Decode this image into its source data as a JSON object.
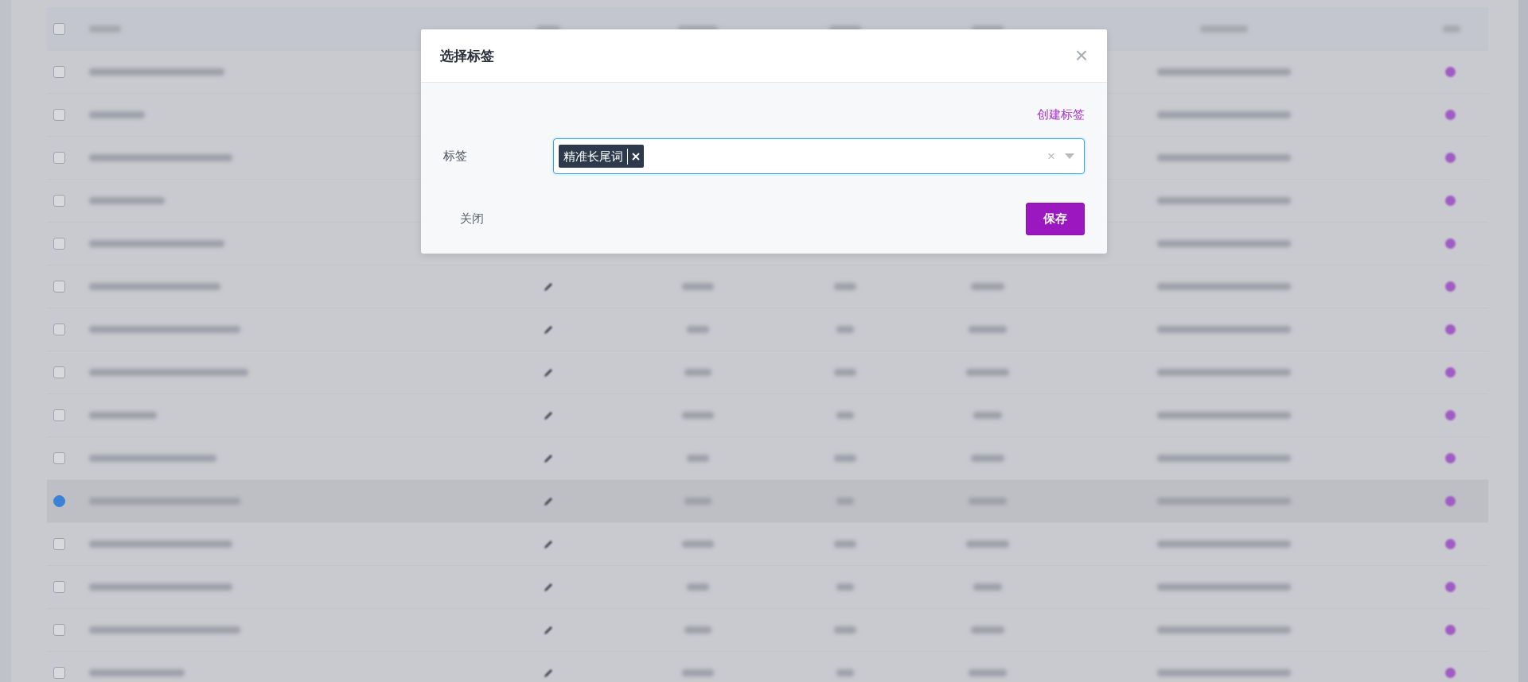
{
  "background_table": {
    "header_checkbox": {
      "checked": false
    },
    "rows": [
      {
        "selected": false
      },
      {
        "selected": false
      },
      {
        "selected": false
      },
      {
        "selected": false
      },
      {
        "selected": false
      },
      {
        "selected": false
      },
      {
        "selected": false
      },
      {
        "selected": false
      },
      {
        "selected": false
      },
      {
        "selected": false
      },
      {
        "selected": true
      },
      {
        "selected": false
      },
      {
        "selected": false
      },
      {
        "selected": false
      },
      {
        "selected": false
      }
    ]
  },
  "dialog": {
    "title": "选择标签",
    "close_icon": "×",
    "create_link": "创建标签",
    "field_label": "标签",
    "tags": [
      {
        "label": "精准长尾词"
      }
    ],
    "clear_icon": "×",
    "close_button": "关闭",
    "save_button": "保存"
  }
}
